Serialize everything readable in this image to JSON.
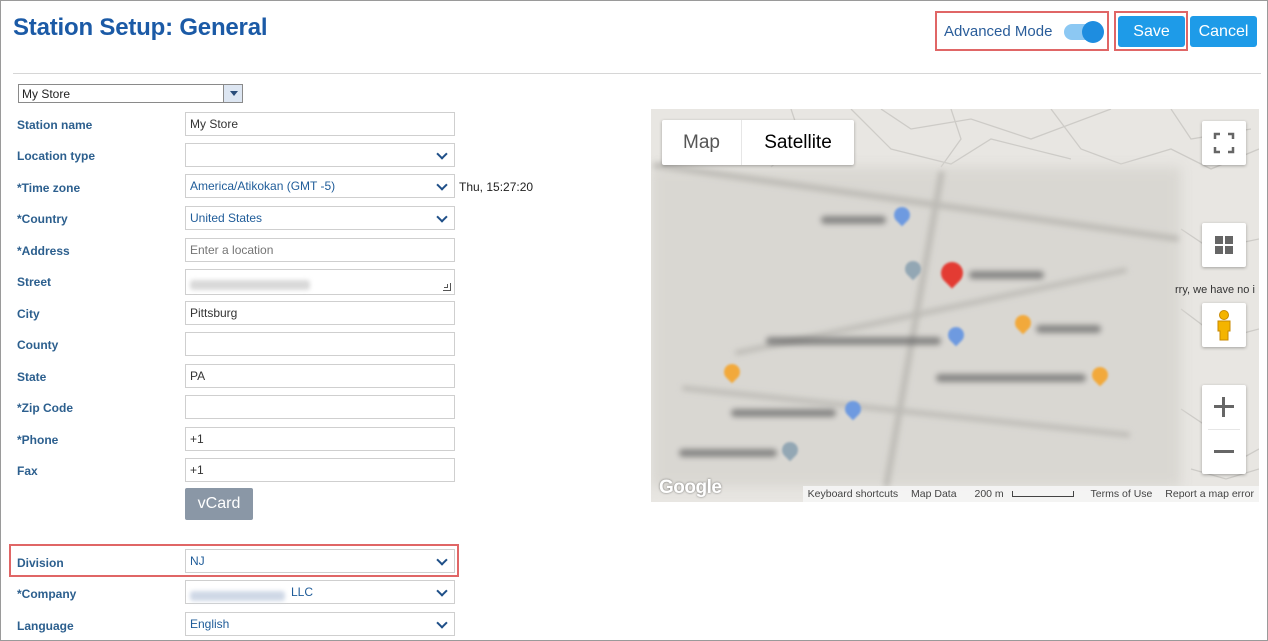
{
  "header": {
    "title": "Station Setup:",
    "title_sub": "General",
    "advanced_mode_label": "Advanced Mode",
    "advanced_mode_on": true,
    "save_label": "Save",
    "cancel_label": "Cancel"
  },
  "store_selector": {
    "value": "My Store"
  },
  "form": {
    "station_name": {
      "label": "Station name",
      "value": "My Store"
    },
    "location_type": {
      "label": "Location type",
      "value": ""
    },
    "time_zone": {
      "label": "*Time zone",
      "value": "America/Atikokan (GMT -5)",
      "current_time": "Thu, 15:27:20"
    },
    "country": {
      "label": "*Country",
      "value": "United States"
    },
    "address": {
      "label": "*Address",
      "placeholder": "Enter a location"
    },
    "street": {
      "label": "Street"
    },
    "city": {
      "label": "City",
      "value": "Pittsburg"
    },
    "county": {
      "label": "County",
      "value": ""
    },
    "state": {
      "label": "State",
      "value": "PA"
    },
    "zip": {
      "label": "*Zip Code",
      "value": ""
    },
    "phone": {
      "label": "*Phone",
      "value": "+1"
    },
    "fax": {
      "label": "Fax",
      "value": "+1"
    },
    "vcard_label": "vCard",
    "division": {
      "label": "Division",
      "value": "NJ"
    },
    "company": {
      "label": "*Company",
      "suffix": "LLC"
    },
    "language": {
      "label": "Language",
      "value": "English"
    }
  },
  "map": {
    "tab_map": "Map",
    "tab_satellite": "Satellite",
    "sorry_text": "rry, we have no i",
    "google_logo": "Google",
    "footer": {
      "keyboard": "Keyboard shortcuts",
      "map_data": "Map Data",
      "scale": "200 m",
      "terms": "Terms of Use",
      "report": "Report a map error"
    }
  },
  "colors": {
    "title": "#1b5aa6",
    "button": "#1e9be8",
    "label": "#2c5f8e",
    "highlight": "#e06666",
    "vcard": "#8a97a6"
  }
}
